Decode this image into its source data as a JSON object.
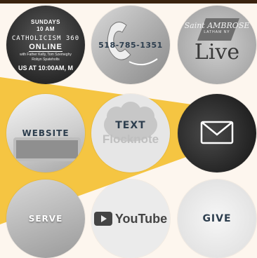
{
  "tiles": {
    "online": {
      "line1": "SUNDAYS",
      "line2": "10 AM",
      "line3": "CATHOLICISM 360",
      "line4": "ONLINE",
      "line5": "with Father Kelly, Tom Szemeghy",
      "line6": "Robyn Spateholts",
      "line7": "US AT 10:00AM, M"
    },
    "phone": {
      "number": "518-785-1351"
    },
    "live": {
      "brand_top": "Saint AMBROSE",
      "brand_sub": "LATHAM NY",
      "live_text": "Live"
    },
    "website": {
      "label": "WEBSITE"
    },
    "text": {
      "label": "TEXT",
      "logo_text": "Flocknote"
    },
    "email": {
      "icon": "envelope-icon"
    },
    "serve": {
      "label": "SERVE"
    },
    "youtube": {
      "logo_text": "YouTube"
    },
    "give": {
      "label": "GIVE"
    }
  },
  "colors": {
    "accent": "#f5c542",
    "bar": "#3a230f",
    "label_dark": "#2d3e4e"
  }
}
